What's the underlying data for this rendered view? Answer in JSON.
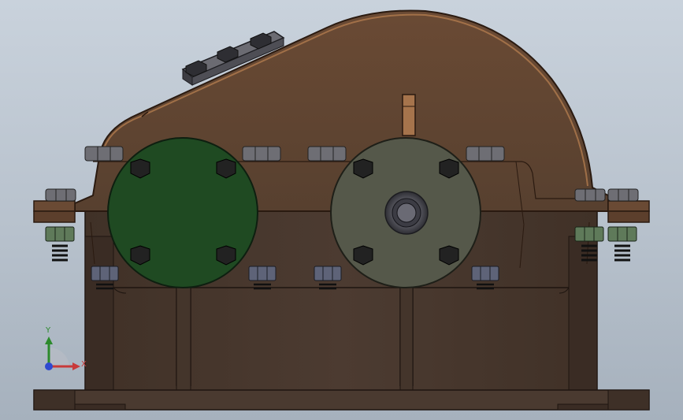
{
  "viewport": {
    "background_top": "#c9d2dc",
    "background_bottom": "#a6b1bd"
  },
  "model": {
    "colors": {
      "housing_cover": "#5e4230",
      "housing_cover_edge": "#2a1a10",
      "housing_base": "#4a3a30",
      "housing_base_dark": "#3a2c24",
      "bearing_cap_left": "#1f4a22",
      "bearing_cap_right": "#55584a",
      "bolt_head": "#4c4c4c",
      "nut_steel": "#6e6e74",
      "nut_green": "#5f7a5a",
      "shaft": "#7c7c86"
    }
  },
  "triad": {
    "y_label": "Y",
    "x_label": "X",
    "y_color": "#2c8a2c",
    "x_color": "#c83a3a",
    "z_color": "#2f4ad0"
  }
}
